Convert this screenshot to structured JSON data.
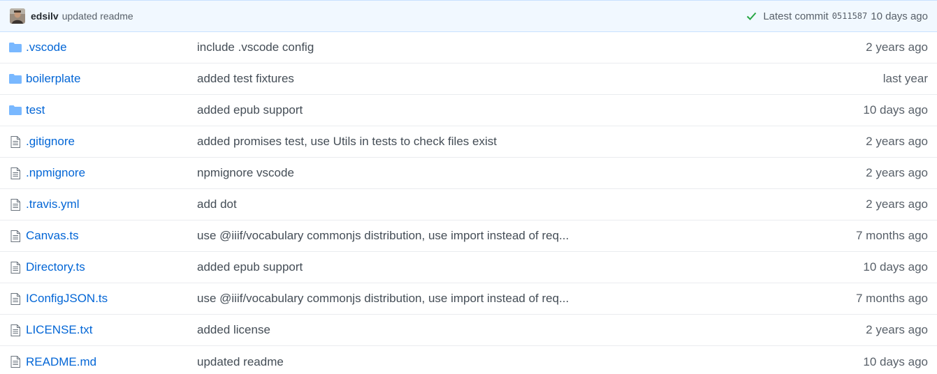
{
  "commit_bar": {
    "author": "edsilv",
    "message": "updated readme",
    "latest_label": "Latest commit",
    "sha": "0511587",
    "age": "10 days ago"
  },
  "colors": {
    "link": "#0366d6",
    "folder_icon": "#79b8ff",
    "file_icon": "#6a737d",
    "check": "#28a745",
    "commit_bar_bg": "#f1f8ff"
  },
  "files": [
    {
      "type": "folder",
      "icon": "folder-icon",
      "name": ".vscode",
      "message": "include .vscode config",
      "age": "2 years ago"
    },
    {
      "type": "folder",
      "icon": "folder-icon",
      "name": "boilerplate",
      "message": "added test fixtures",
      "age": "last year"
    },
    {
      "type": "folder",
      "icon": "folder-icon",
      "name": "test",
      "message": "added epub support",
      "age": "10 days ago"
    },
    {
      "type": "file",
      "icon": "file-icon",
      "name": ".gitignore",
      "message": "added promises test, use Utils in tests to check files exist",
      "age": "2 years ago"
    },
    {
      "type": "file",
      "icon": "file-icon",
      "name": ".npmignore",
      "message": "npmignore vscode",
      "age": "2 years ago"
    },
    {
      "type": "file",
      "icon": "file-icon",
      "name": ".travis.yml",
      "message": "add dot",
      "age": "2 years ago"
    },
    {
      "type": "file",
      "icon": "file-icon",
      "name": "Canvas.ts",
      "message": "use @iiif/vocabulary commonjs distribution, use import instead of req...",
      "age": "7 months ago"
    },
    {
      "type": "file",
      "icon": "file-icon",
      "name": "Directory.ts",
      "message": "added epub support",
      "age": "10 days ago"
    },
    {
      "type": "file",
      "icon": "file-icon",
      "name": "IConfigJSON.ts",
      "message": "use @iiif/vocabulary commonjs distribution, use import instead of req...",
      "age": "7 months ago"
    },
    {
      "type": "file",
      "icon": "file-icon",
      "name": "LICENSE.txt",
      "message": "added license",
      "age": "2 years ago"
    },
    {
      "type": "file",
      "icon": "file-icon",
      "name": "README.md",
      "message": "updated readme",
      "age": "10 days ago"
    }
  ]
}
